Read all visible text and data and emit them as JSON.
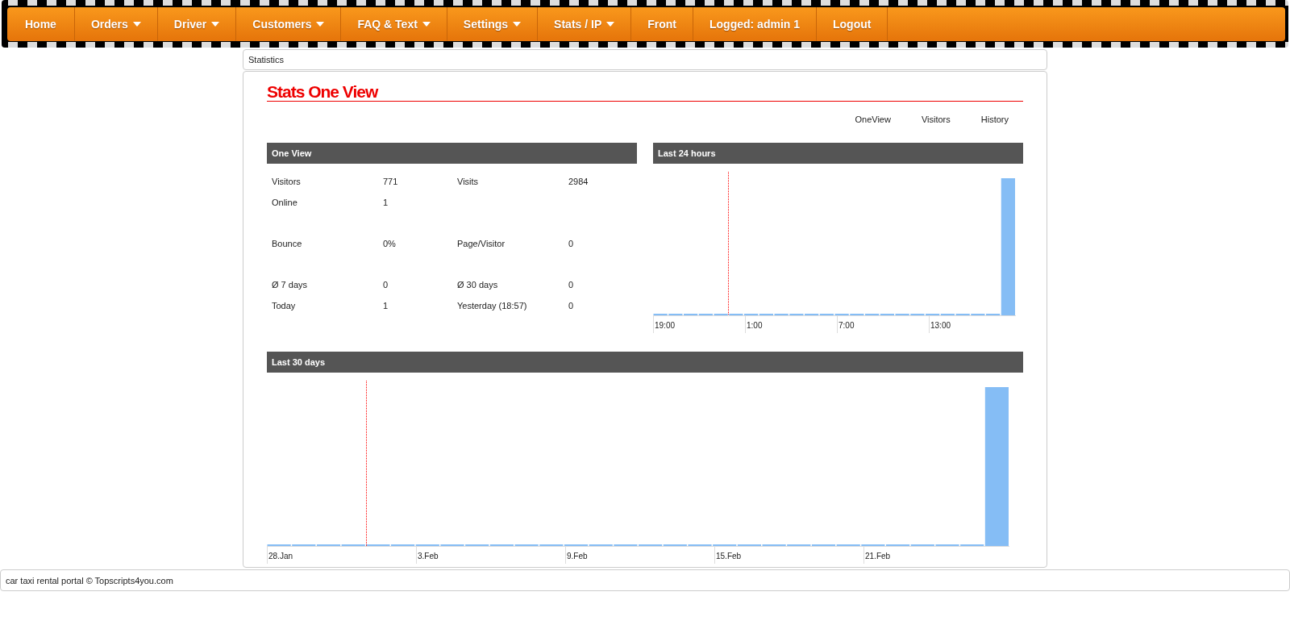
{
  "nav": [
    {
      "label": "Home",
      "dropdown": false
    },
    {
      "label": "Orders",
      "dropdown": true
    },
    {
      "label": "Driver",
      "dropdown": true
    },
    {
      "label": "Customers",
      "dropdown": true
    },
    {
      "label": "FAQ & Text",
      "dropdown": true
    },
    {
      "label": "Settings",
      "dropdown": true
    },
    {
      "label": "Stats / IP",
      "dropdown": true
    },
    {
      "label": "Front",
      "dropdown": false
    },
    {
      "label": "Logged: admin 1",
      "dropdown": false
    },
    {
      "label": "Logout",
      "dropdown": false
    }
  ],
  "breadcrumb": "Statistics",
  "title": "Stats One View",
  "tabs": [
    "OneView",
    "Visitors",
    "History"
  ],
  "one_view": {
    "heading": "One View",
    "rows": [
      {
        "label_1": "Visitors",
        "value_1": "771",
        "label_2": "Visits",
        "value_2": "2984",
        "gap_after": false
      },
      {
        "label_1": "Online",
        "value_1": "1",
        "label_2": "",
        "value_2": "",
        "gap_after": true
      },
      {
        "label_1": "Bounce",
        "value_1": "0%",
        "label_2": "Page/Visitor",
        "value_2": "0",
        "gap_after": true
      },
      {
        "label_1": "Ø 7 days",
        "value_1": "0",
        "label_2": "Ø 30 days",
        "value_2": "0",
        "gap_after": false
      },
      {
        "label_1": "Today",
        "value_1": "1",
        "label_2": "Yesterday (18:57)",
        "value_2": "0",
        "gap_after": false
      }
    ]
  },
  "last_24_hours": {
    "heading": "Last 24 hours",
    "x_labels": [
      "19:00",
      "1:00",
      "7:00",
      "13:00"
    ]
  },
  "last_30_days": {
    "heading": "Last 30 days",
    "x_labels": [
      "28.Jan",
      "3.Feb",
      "9.Feb",
      "15.Feb",
      "21.Feb"
    ]
  },
  "footer": "car taxi rental portal © Topscripts4you.com"
}
